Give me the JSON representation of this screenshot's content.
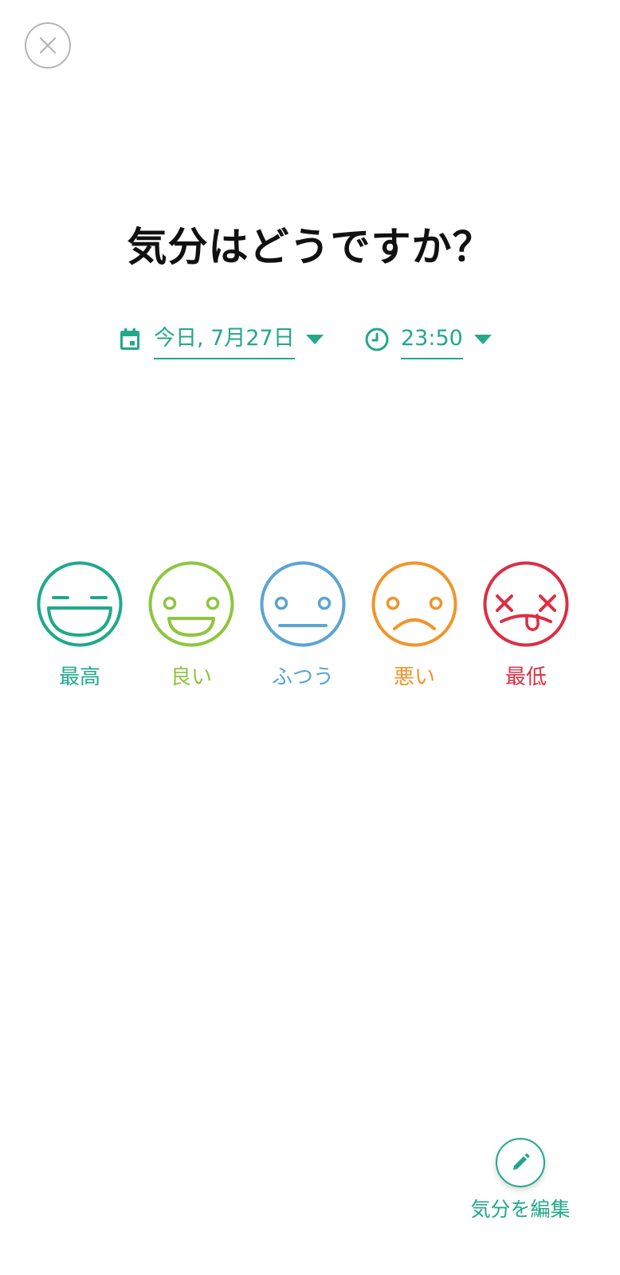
{
  "header": {
    "close_icon": "close-icon"
  },
  "title": "気分はどうですか？",
  "date_picker": {
    "value": "今日, 7月27日",
    "icon": "calendar-icon"
  },
  "time_picker": {
    "value": "23:50",
    "icon": "clock-icon"
  },
  "moods": [
    {
      "label": "最高",
      "color": "#1fa98b",
      "icon": "laughing-face-icon"
    },
    {
      "label": "良い",
      "color": "#8dc63f",
      "icon": "smiling-face-icon"
    },
    {
      "label": "ふつう",
      "color": "#5ba4d4",
      "icon": "neutral-face-icon"
    },
    {
      "label": "悪い",
      "color": "#f0952a",
      "icon": "sad-face-icon"
    },
    {
      "label": "最低",
      "color": "#dc2e44",
      "icon": "dizzy-face-icon"
    }
  ],
  "edit": {
    "label": "気分を編集",
    "icon": "pencil-icon"
  },
  "colors": {
    "accent": "#22a88a",
    "close_border": "#b5b5b5",
    "title": "#111111"
  }
}
